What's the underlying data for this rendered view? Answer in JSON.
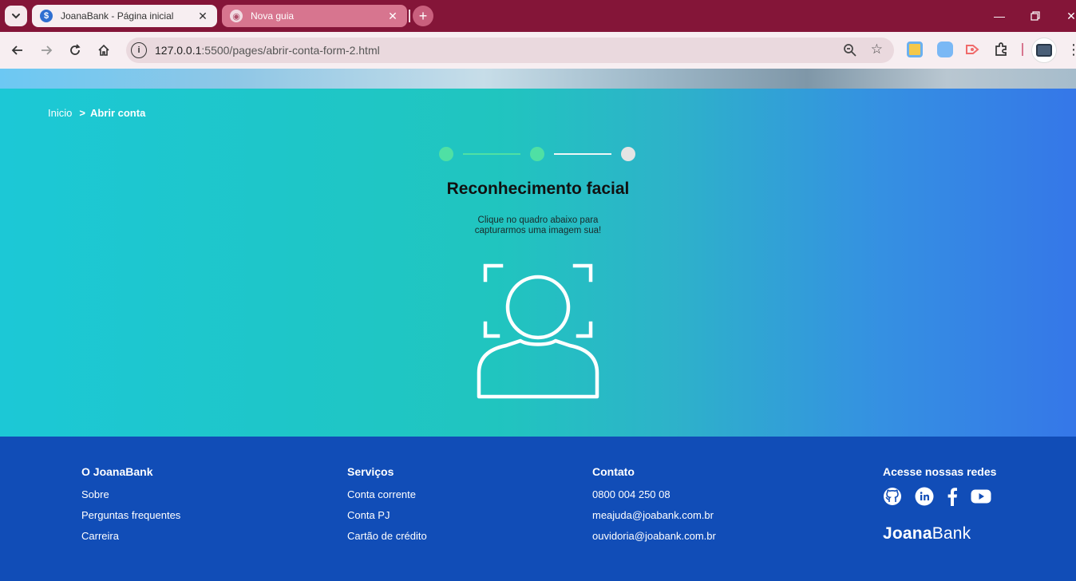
{
  "browser": {
    "tabs": [
      {
        "title": "JoanaBank - Página inicial",
        "active": true
      },
      {
        "title": "Nova guia",
        "active": false
      }
    ],
    "url_host": "127.0.0.1",
    "url_path": ":5500/pages/abrir-conta-form-2.html"
  },
  "breadcrumb": {
    "home": "Inicio",
    "separator": ">",
    "current": "Abrir conta"
  },
  "progress": {
    "total_steps": 3,
    "completed_steps": 2,
    "done_color": "#4fe0a4",
    "pending_color": "#e4e4e4"
  },
  "main": {
    "title": "Reconhecimento facial",
    "instruction_line1": "Clique no quadro abaixo para",
    "instruction_line2": "capturarmos uma imagem sua!"
  },
  "footer": {
    "col1": {
      "title": "O JoanaBank",
      "links": [
        "Sobre",
        "Perguntas frequentes",
        "Carreira"
      ]
    },
    "col2": {
      "title": "Serviços",
      "links": [
        "Conta corrente",
        "Conta PJ",
        "Cartão de crédito"
      ]
    },
    "col3": {
      "title": "Contato",
      "items": [
        "0800 004 250 08",
        "meajuda@joabank.com.br",
        "ouvidoria@joabank.com.br"
      ]
    },
    "col4": {
      "title": "Acesse nossas redes",
      "icons": [
        "github-icon",
        "linkedin-icon",
        "facebook-icon",
        "youtube-icon"
      ]
    },
    "logo_bold": "Joana",
    "logo_regular": "Bank"
  },
  "colors": {
    "tabbar": "#841538",
    "footer_bg": "#114db7",
    "main_gradient_start": "#1cc8d6",
    "main_gradient_end": "#3577e8"
  }
}
